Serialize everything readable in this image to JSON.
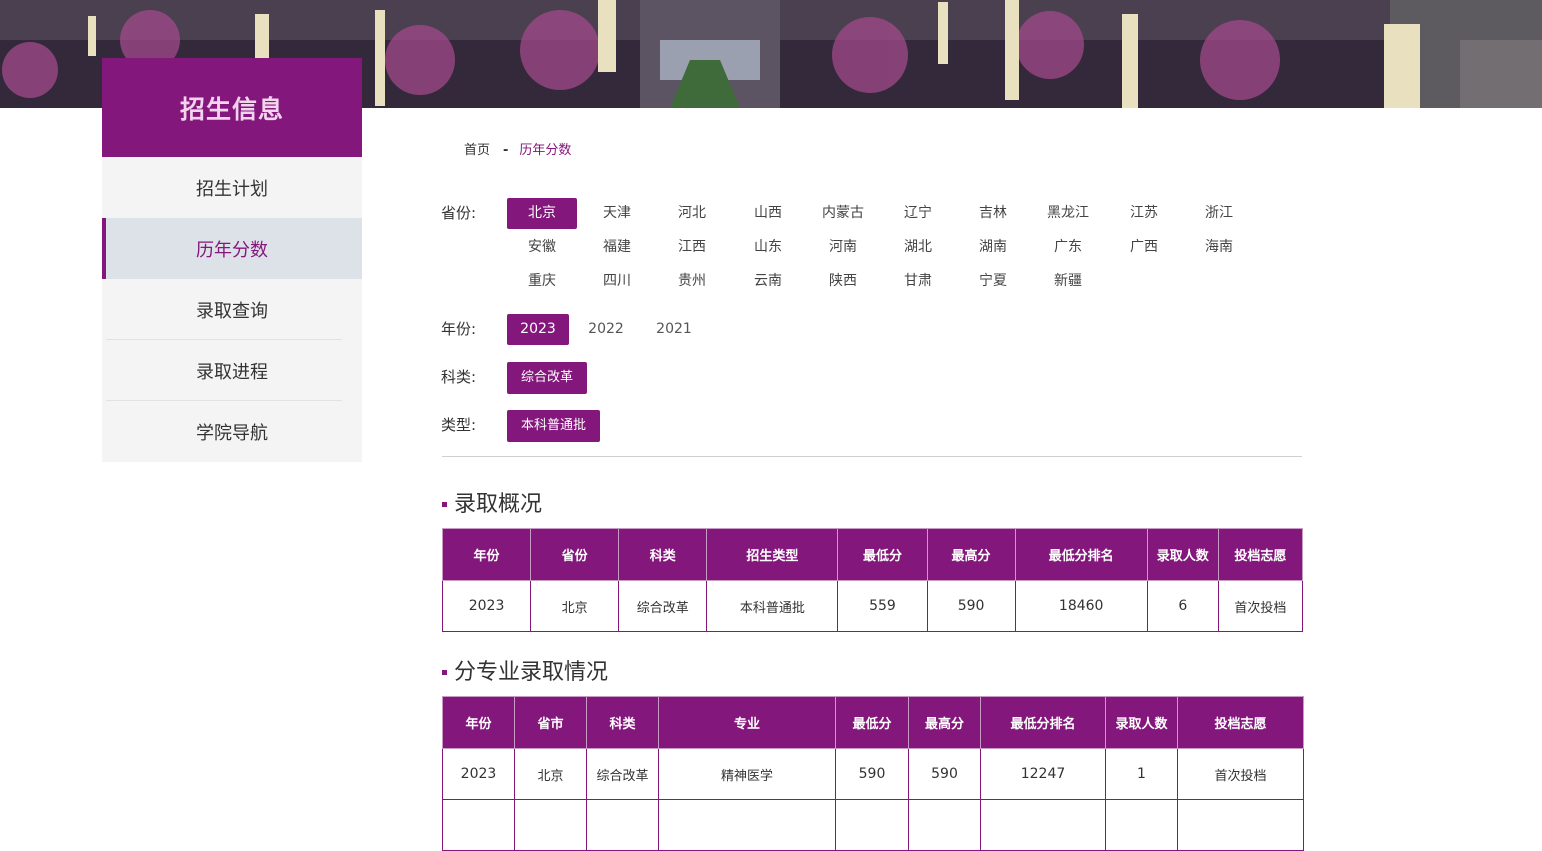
{
  "sidebar": {
    "title": "招生信息",
    "items": [
      {
        "label": "招生计划"
      },
      {
        "label": "历年分数"
      },
      {
        "label": "录取查询"
      },
      {
        "label": "录取进程"
      },
      {
        "label": "学院导航"
      }
    ]
  },
  "breadcrumb": {
    "home": "首页",
    "separator": "-",
    "current": "历年分数"
  },
  "filters": {
    "province_label": "省份:",
    "provinces": [
      "北京",
      "天津",
      "河北",
      "山西",
      "内蒙古",
      "辽宁",
      "吉林",
      "黑龙江",
      "江苏",
      "浙江",
      "安徽",
      "福建",
      "江西",
      "山东",
      "河南",
      "湖北",
      "湖南",
      "广东",
      "广西",
      "海南",
      "重庆",
      "四川",
      "贵州",
      "云南",
      "陕西",
      "甘肃",
      "宁夏",
      "新疆"
    ],
    "selected_province": "北京",
    "year_label": "年份:",
    "years": [
      "2023",
      "2022",
      "2021"
    ],
    "selected_year": "2023",
    "subject_label": "科类:",
    "subject": "综合改革",
    "type_label": "类型:",
    "type": "本科普通批"
  },
  "overview": {
    "title": "录取概况",
    "headers": [
      "年份",
      "省份",
      "科类",
      "招生类型",
      "最低分",
      "最高分",
      "最低分排名",
      "录取人数",
      "投档志愿"
    ],
    "rows": [
      [
        "2023",
        "北京",
        "综合改革",
        "本科普通批",
        "559",
        "590",
        "18460",
        "6",
        "首次投档"
      ]
    ]
  },
  "majors": {
    "title": "分专业录取情况",
    "headers": [
      "年份",
      "省市",
      "科类",
      "专业",
      "最低分",
      "最高分",
      "最低分排名",
      "录取人数",
      "投档志愿"
    ],
    "rows": [
      [
        "2023",
        "北京",
        "综合改革",
        "精神医学",
        "590",
        "590",
        "12247",
        "1",
        "首次投档"
      ]
    ]
  },
  "colors": {
    "accent": "#84177c",
    "accent_text": "#f3d4ee",
    "active_bg": "#dde1e8"
  }
}
